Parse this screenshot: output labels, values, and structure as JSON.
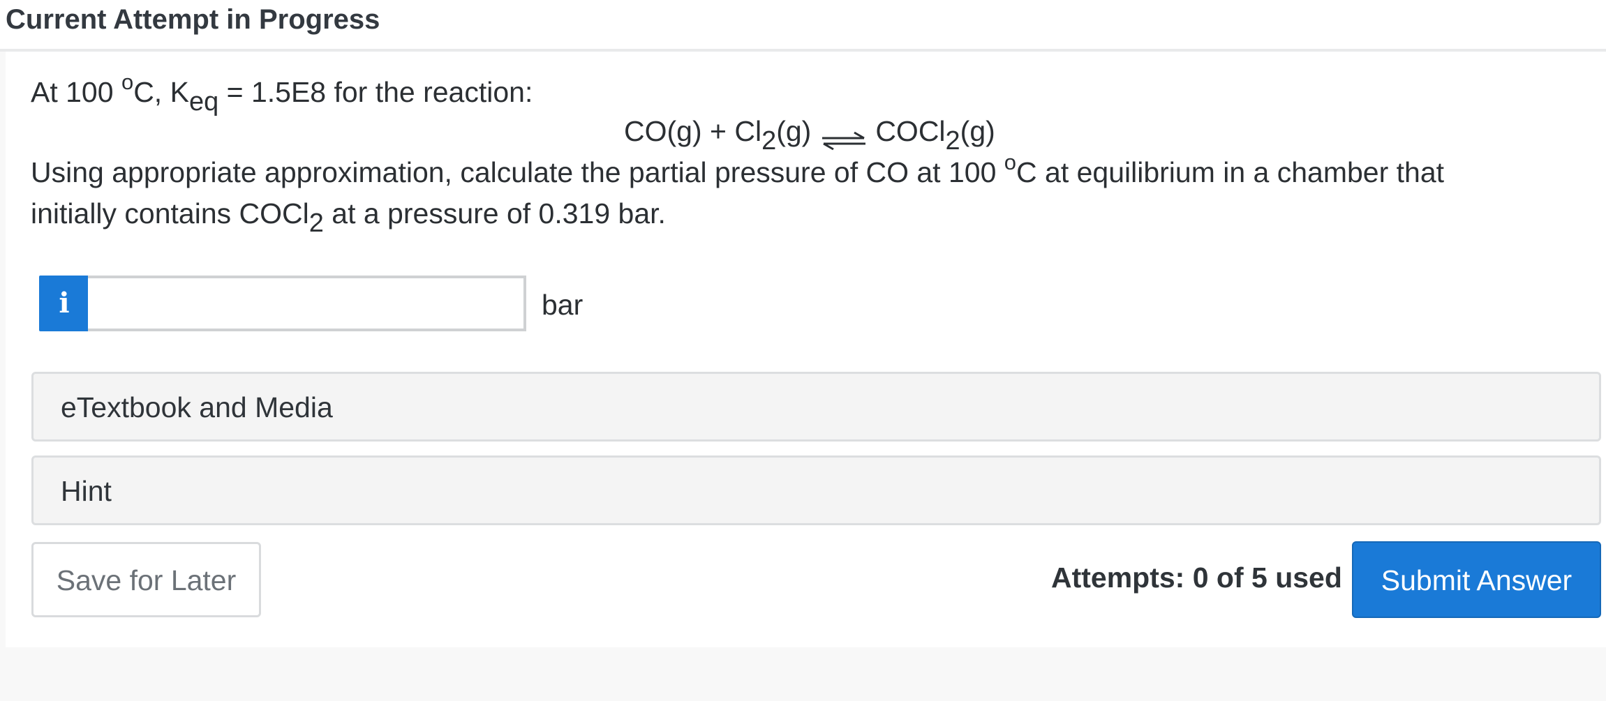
{
  "header": {
    "title": "Current Attempt in Progress"
  },
  "question": {
    "line1_prefix": "At 100 ",
    "degree_symbol": "o",
    "line1_after_degree": "C, K",
    "keq_subscript": "eq",
    "line1_suffix": " = 1.5E8 for the reaction:",
    "reaction_reactant1": "CO(g) + Cl",
    "reaction_reactant1_subscript": "2",
    "reaction_reactant1_end": "(g)",
    "reaction_product": "COCl",
    "reaction_product_subscript": "2",
    "reaction_product_end": "(g)",
    "line2_prefix": "Using appropriate approximation, calculate the partial pressure of CO at 100 ",
    "line2_degree": "o",
    "line2_suffix": "C at equilibrium in a chamber that",
    "line3_prefix": "initially contains COCl",
    "line3_subscript": "2",
    "line3_suffix": " at a pressure of 0.319 bar."
  },
  "answer": {
    "info_icon_glyph": "i",
    "input_value": "",
    "input_placeholder": "",
    "unit": "bar"
  },
  "sections": {
    "etextbook_label": "eTextbook and Media",
    "hint_label": "Hint"
  },
  "footer": {
    "save_label": "Save for Later",
    "attempts_text": "Attempts: 0 of 5 used",
    "submit_label": "Submit Answer"
  },
  "colors": {
    "accent": "#1a7ad7",
    "background": "#f8f8f8",
    "panel": "#f4f4f4"
  },
  "icons": {
    "info": "info-icon",
    "equilibrium_arrow": "equilibrium-arrow-icon"
  }
}
